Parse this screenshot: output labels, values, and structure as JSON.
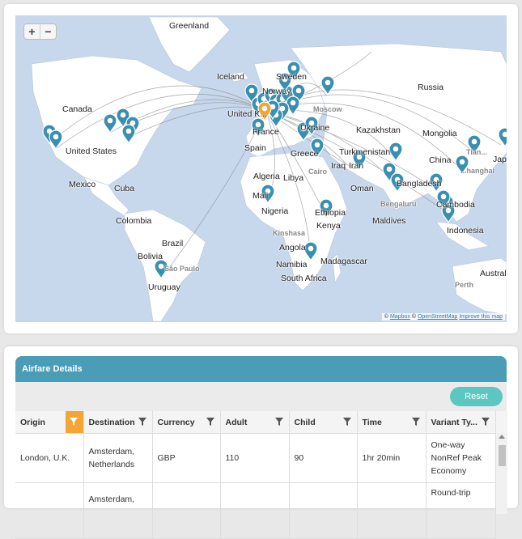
{
  "map": {
    "zoom_in": "+",
    "zoom_out": "−",
    "attribution": {
      "prefix": "©",
      "mapbox": "Mapbox",
      "sep": "©",
      "osm": "OpenStreetMap",
      "improve": "Improve this map"
    },
    "labels": {
      "greenland": "Greenland",
      "iceland": "Iceland",
      "sweden": "Sweden",
      "norway": "Norway",
      "russia": "Russia",
      "canada": "Canada",
      "moscow": "Moscow",
      "united_kingdom": "United K...",
      "ukraine": "Ukraine",
      "kazakhstan": "Kazakhstan",
      "mongolia": "Mongolia",
      "france": "France",
      "united_states": "United States",
      "spain": "Spain",
      "greece": "Greece",
      "turkmenistan": "Turkmenistan",
      "china": "China",
      "tianjin": "Tian...",
      "japan": "Japa...",
      "iraq": "Iraq",
      "iran": "Iran",
      "cairo": "Cairo",
      "shanghai": "...hanghai",
      "algeria": "Algeria",
      "libya": "Libya",
      "mexico": "Mexico",
      "cuba": "Cuba",
      "oman": "Oman",
      "bangladesh": "Bangladesh",
      "mali": "Mali",
      "cambodia": "Cambodia",
      "bengaluru": "Bengaluru",
      "nigeria": "Nigeria",
      "ethiopia": "Ethiopia",
      "colombia": "Colombia",
      "kinshasa": "Kinshasa",
      "maldives": "Maldives",
      "kenya": "Kenya",
      "indonesia": "Indonesia",
      "brazil": "Brazil",
      "angola": "Angola",
      "bolivia": "Bolivia",
      "madagascar": "Madagascar",
      "namibia": "Namibia",
      "sao_paulo": "São Paulo",
      "south_africa": "South Africa",
      "australia": "Austral...",
      "uruguay": "Uruguay",
      "perth": "Perth"
    }
  },
  "fares": {
    "title": "Airfare Details",
    "reset_label": "Reset",
    "columns": [
      "Origin",
      "Destination",
      "Currency",
      "Adult",
      "Child",
      "Time",
      "Variant Ty..."
    ],
    "rows": [
      {
        "origin": "London, U.K.",
        "destination": "Amsterdam, Netherlands",
        "currency": "GBP",
        "adult": "110",
        "child": "90",
        "time": "1hr 20min",
        "variant": "One-way NonRef Peak Economy"
      },
      {
        "origin": "",
        "destination": "Amsterdam,",
        "currency": "",
        "adult": "",
        "child": "",
        "time": "",
        "variant": "Round-trip"
      }
    ]
  },
  "colors": {
    "marker": "#3a8fb0",
    "origin_marker": "#f4a533",
    "header": "#4a9db7",
    "reset": "#5cc7c1",
    "water": "#c7d7ec",
    "land": "#ffffff"
  }
}
